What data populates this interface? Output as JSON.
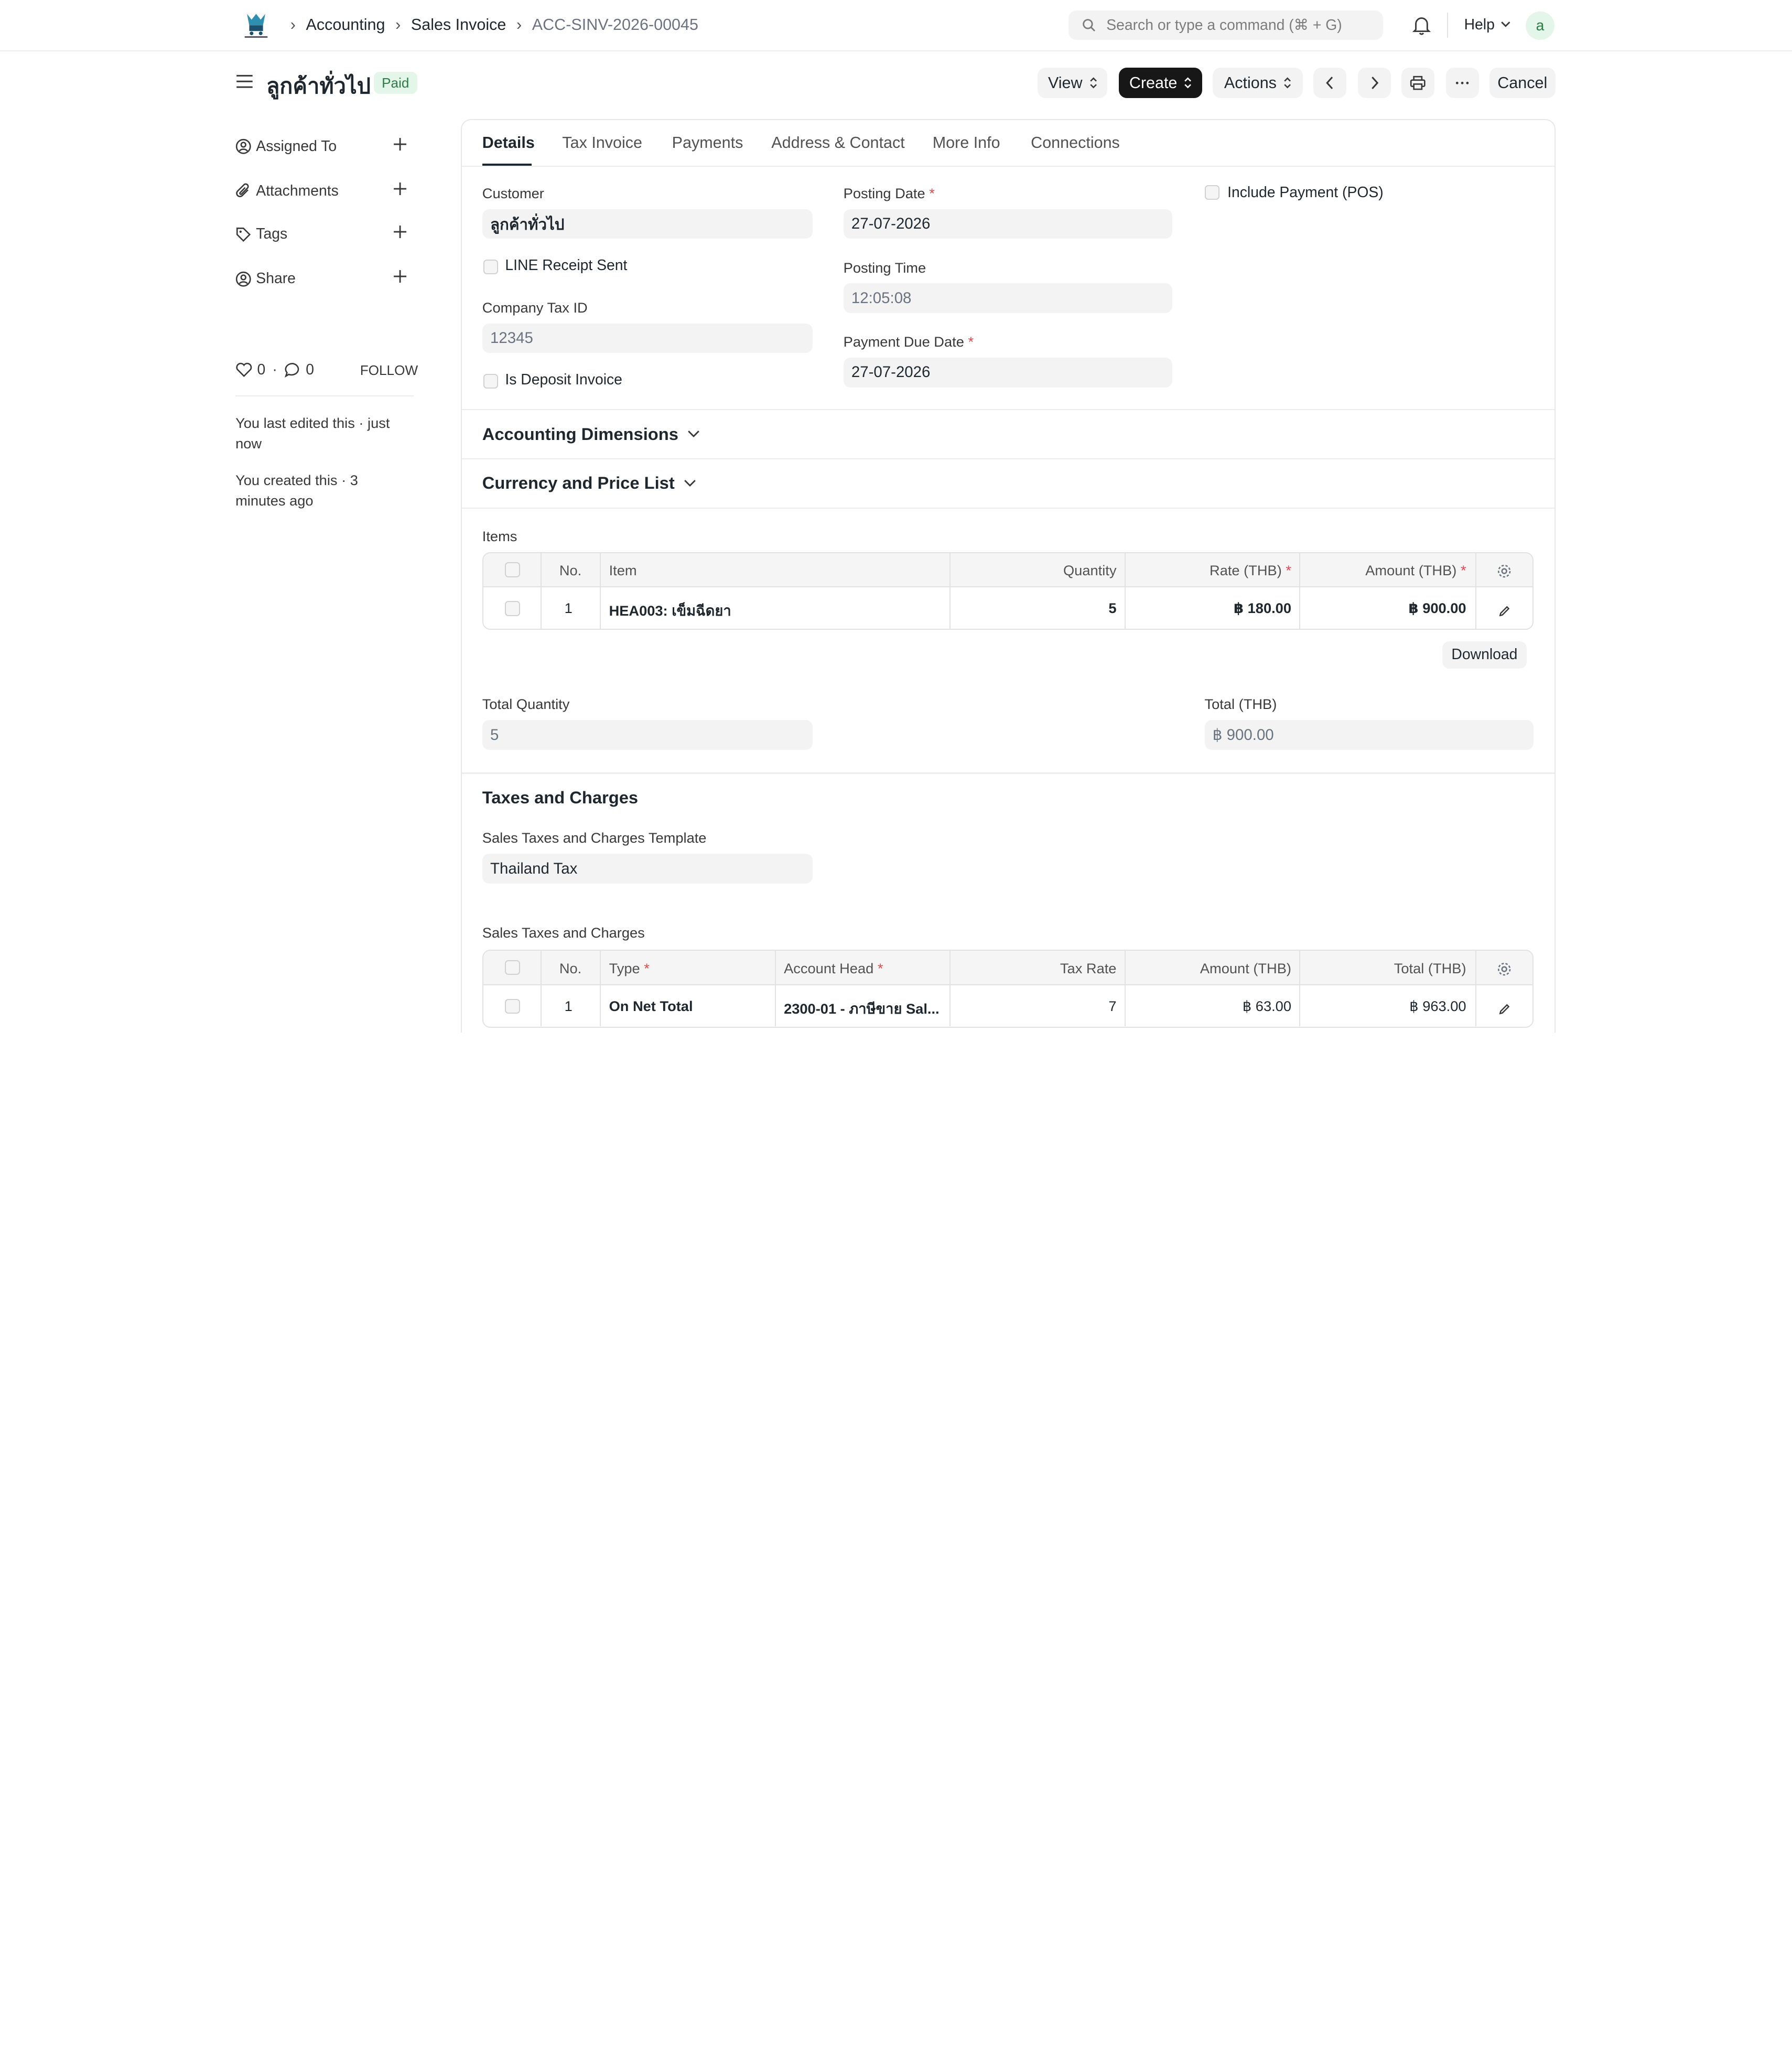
{
  "navbar": {
    "breadcrumbs": [
      "Accounting",
      "Sales Invoice",
      "ACC-SINV-2026-00045"
    ],
    "search_placeholder": "Search or type a command (⌘ + G)",
    "help_label": "Help",
    "avatar_letter": "a"
  },
  "page": {
    "title": "ลูกค้าทั่วไป",
    "status": "Paid",
    "buttons": {
      "view": "View",
      "create": "Create",
      "actions": "Actions",
      "cancel": "Cancel"
    }
  },
  "sidebar": {
    "items": [
      {
        "label": "Assigned To",
        "icon": "user-assign-icon"
      },
      {
        "label": "Attachments",
        "icon": "paperclip-icon"
      },
      {
        "label": "Tags",
        "icon": "tag-icon"
      },
      {
        "label": "Share",
        "icon": "share-user-icon"
      }
    ],
    "likes": "0",
    "comments": "0",
    "follow": "FOLLOW",
    "last_edited": "You last edited this · just now",
    "created": "You created this · 3 minutes ago"
  },
  "tabs": [
    "Details",
    "Tax Invoice",
    "Payments",
    "Address & Contact",
    "More Info",
    "Connections"
  ],
  "details": {
    "customer_label": "Customer",
    "customer_value": "ลูกค้าทั่วไป",
    "line_receipt_label": "LINE Receipt Sent",
    "company_tax_label": "Company Tax ID",
    "company_tax_value": "12345",
    "deposit_label": "Is Deposit Invoice",
    "posting_date_label": "Posting Date",
    "posting_date_value": "27-07-2026",
    "posting_time_label": "Posting Time",
    "posting_time_value": "12:05:08",
    "due_date_label": "Payment Due Date",
    "due_date_value": "27-07-2026",
    "include_payment_label": "Include Payment (POS)",
    "required_mark": "*"
  },
  "sections": {
    "accounting_dimensions": "Accounting Dimensions",
    "currency": "Currency and Price List",
    "taxes": "Taxes and Charges"
  },
  "items": {
    "label": "Items",
    "headers": [
      "No.",
      "Item",
      "Quantity",
      "Rate (THB)",
      "Amount (THB)"
    ],
    "rows": [
      {
        "no": "1",
        "item": "HEA003: เข็มฉีดยา",
        "qty": "5",
        "rate": "฿ 180.00",
        "amount": "฿ 900.00"
      }
    ],
    "download": "Download",
    "total_qty_label": "Total Quantity",
    "total_qty_value": "5",
    "total_label": "Total (THB)",
    "total_value": "฿ 900.00"
  },
  "taxes": {
    "template_label": "Sales Taxes and Charges Template",
    "template_value": "Thailand Tax",
    "table_label": "Sales Taxes and Charges",
    "headers": [
      "No.",
      "Type",
      "Account Head",
      "Tax Rate",
      "Amount (THB)",
      "Total (THB)"
    ],
    "rows": [
      {
        "no": "1",
        "type": "On Net Total",
        "account": "2300-01 - ภาษีขาย Sal...",
        "rate": "7",
        "amount": "฿ 63.00",
        "total": "฿ 963.00"
      }
    ]
  }
}
